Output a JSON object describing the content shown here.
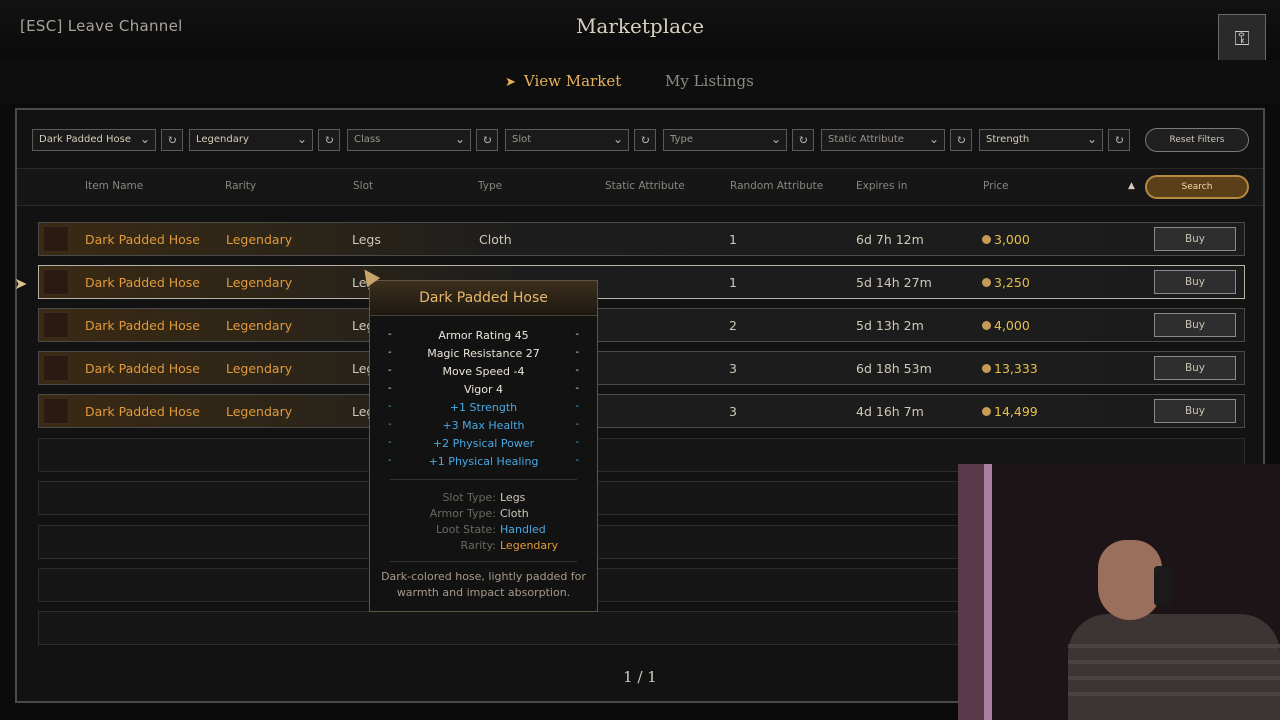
{
  "header": {
    "leave": "[ESC] Leave Channel",
    "title": "Marketplace"
  },
  "tabs": [
    {
      "label": "View Market",
      "active": true
    },
    {
      "label": "My Listings",
      "active": false
    }
  ],
  "filters": {
    "item": "Dark Padded Hose",
    "rarity": "Legendary",
    "class": "Class",
    "slot": "Slot",
    "type": "Type",
    "static_attribute": "Static Attribute",
    "random_attribute": "Strength",
    "reset_label": "Reset Filters",
    "search_label": "Search"
  },
  "columns": [
    "Item Name",
    "Rarity",
    "Slot",
    "Type",
    "Static Attribute",
    "Random Attribute",
    "Expires in",
    "Price"
  ],
  "rows": [
    {
      "name": "Dark Padded Hose",
      "rarity": "Legendary",
      "slot": "Legs",
      "type": "Cloth",
      "random": "1",
      "expires": "6d 7h 12m",
      "price": "3,000",
      "buy": "Buy"
    },
    {
      "name": "Dark Padded Hose",
      "rarity": "Legendary",
      "slot": "Legs",
      "type": "",
      "random": "1",
      "expires": "5d 14h 27m",
      "price": "3,250",
      "buy": "Buy"
    },
    {
      "name": "Dark Padded Hose",
      "rarity": "Legendary",
      "slot": "Leg",
      "type": "",
      "random": "2",
      "expires": "5d 13h 2m",
      "price": "4,000",
      "buy": "Buy"
    },
    {
      "name": "Dark Padded Hose",
      "rarity": "Legendary",
      "slot": "Leg",
      "type": "",
      "random": "3",
      "expires": "6d 18h 53m",
      "price": "13,333",
      "buy": "Buy"
    },
    {
      "name": "Dark Padded Hose",
      "rarity": "Legendary",
      "slot": "Leg",
      "type": "",
      "random": "3",
      "expires": "4d 16h 7m",
      "price": "14,499",
      "buy": "Buy"
    }
  ],
  "pagination": "1 / 1",
  "tooltip": {
    "title": "Dark Padded Hose",
    "static": [
      "Armor Rating 45",
      "Magic Resistance 27",
      "Move Speed -4",
      "Vigor 4"
    ],
    "random": [
      "+1 Strength",
      "+3 Max Health",
      "+2 Physical Power",
      "+1 Physical Healing"
    ],
    "info": [
      {
        "k": "Slot Type:",
        "v": "Legs"
      },
      {
        "k": "Armor Type:",
        "v": "Cloth"
      },
      {
        "k": "Loot State:",
        "v": "Handled"
      },
      {
        "k": "Rarity:",
        "v": "Legendary"
      }
    ],
    "description": "Dark-colored hose, lightly padded for warmth and impact absorption."
  },
  "colors": {
    "gold": "#e19a3c",
    "price": "#e7c04a",
    "blue_stat": "#49a8e4",
    "active_tab": "#e6b35a"
  }
}
